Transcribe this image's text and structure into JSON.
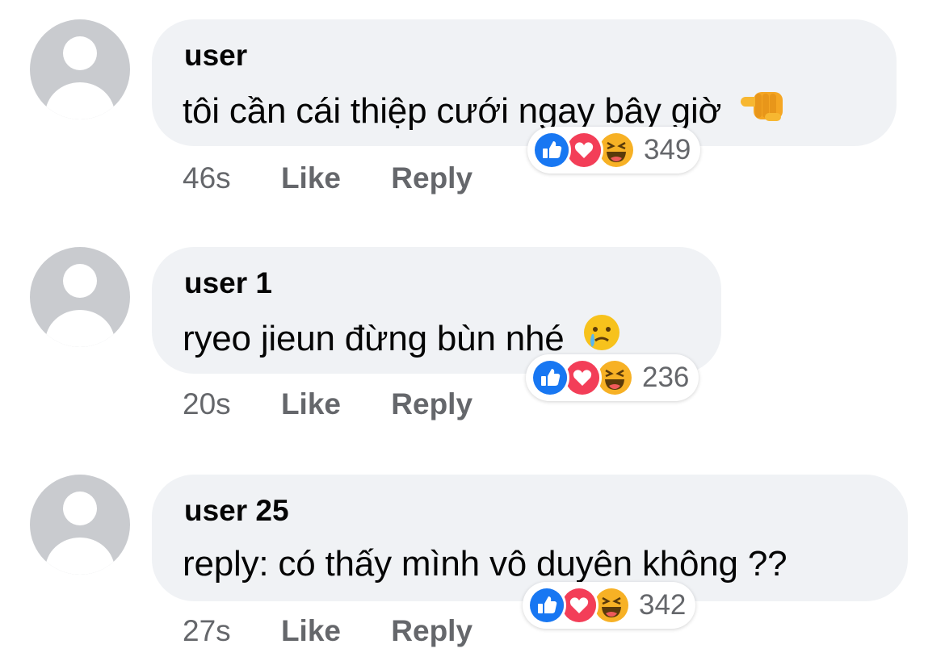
{
  "comments": [
    {
      "username": "user",
      "text": "tôi cần cái thiệp cưới ngay bây giờ",
      "emoji": "pointing-fist-emoji",
      "time": "46s",
      "like_label": "Like",
      "reply_label": "Reply",
      "reaction_count": "349"
    },
    {
      "username": "user 1",
      "text": "ryeo jieun đừng bùn nhé",
      "emoji": "crying-face-emoji",
      "time": "20s",
      "like_label": "Like",
      "reply_label": "Reply",
      "reaction_count": "236"
    },
    {
      "username": "user 25",
      "text": "reply: có thấy mình vô duyên không ??",
      "emoji": "",
      "time": "27s",
      "like_label": "Like",
      "reply_label": "Reply",
      "reaction_count": "342"
    }
  ],
  "colors": {
    "bubble": "#f0f2f5",
    "like": "#1877f2",
    "love": "#f33e58",
    "haha": "#f7b125",
    "meta": "#65676b"
  }
}
